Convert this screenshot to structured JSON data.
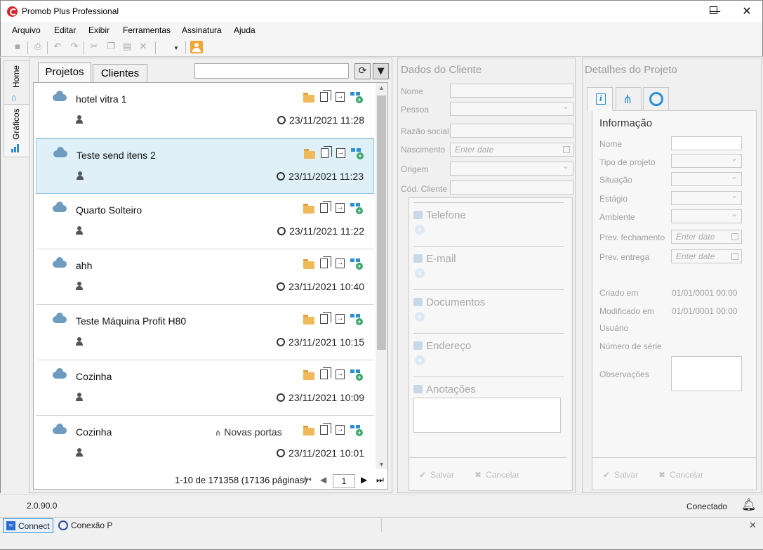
{
  "window": {
    "title": "Promob Plus Professional",
    "minimize": "—",
    "maximize": "☐",
    "close": "✕"
  },
  "menu": [
    "Arquivo",
    "Editar",
    "Exibir",
    "Ferramentas",
    "Assinatura",
    "Ajuda"
  ],
  "left_tabs": {
    "home": "Home",
    "graficos": "Gráficos"
  },
  "projects": {
    "tabs": {
      "projetos": "Projetos",
      "clientes": "Clientes"
    },
    "search_value": "",
    "rows": [
      {
        "name": "hotel vitra 1",
        "date": "23/11/2021 11:28",
        "extra": ""
      },
      {
        "name": "Teste send itens 2",
        "date": "23/11/2021 11:23",
        "extra": ""
      },
      {
        "name": "Quarto Solteiro",
        "date": "23/11/2021 11:22",
        "extra": ""
      },
      {
        "name": "ahh",
        "date": "23/11/2021 10:40",
        "extra": ""
      },
      {
        "name": "Teste Máquina Profit H80",
        "date": "23/11/2021 10:15",
        "extra": ""
      },
      {
        "name": "Cozinha",
        "date": "23/11/2021 10:09",
        "extra": ""
      },
      {
        "name": "Cozinha",
        "date": "23/11/2021 10:01",
        "extra": "Novas portas"
      }
    ],
    "pager_text": "1-10 de 171358 (17136 páginas)",
    "page": "1"
  },
  "client": {
    "title": "Dados do Cliente",
    "fields": {
      "nome": "Nome",
      "pessoa": "Pessoa",
      "razao": "Razão social",
      "nascimento": "Nascimento",
      "origem": "Origem",
      "cod": "Cód. Cliente"
    },
    "date_placeholder": "Enter date",
    "sections": {
      "telefone": "Telefone",
      "email": "E-mail",
      "documentos": "Documentos",
      "endereco": "Endereço",
      "anotacoes": "Anotações"
    },
    "save": "Salvar",
    "cancel": "Cancelar"
  },
  "details": {
    "title": "Detalhes do Projeto",
    "info_heading": "Informação",
    "fields": {
      "nome": "Nome",
      "tipo": "Tipo de projeto",
      "situacao": "Situação",
      "estagio": "Estágio",
      "ambiente": "Ambiente",
      "prev_fech": "Prev. fechamento",
      "prev_ent": "Prev. entrega",
      "criado": "Criado em",
      "modificado": "Modificado em",
      "usuario": "Usuário",
      "serie": "Número de série",
      "obs": "Observações"
    },
    "date_placeholder": "Enter date",
    "criado_value": "01/01/0001 00:00",
    "modificado_value": "01/01/0001 00:00",
    "save": "Salvar",
    "cancel": "Cancelar"
  },
  "status": {
    "version": "2.0.90.0",
    "connection": "Conectado"
  },
  "taskbar": {
    "connect": "Connect",
    "conexao": "Conexão P"
  },
  "colors": {
    "selection": "#dff0f8",
    "accent": "#2b8fd4",
    "brand": "#d6262a"
  }
}
